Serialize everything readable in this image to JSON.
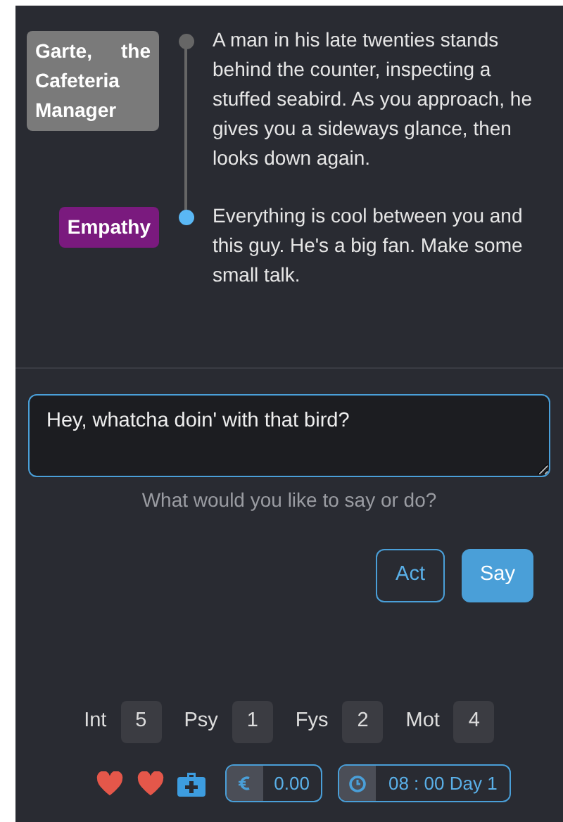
{
  "log": [
    {
      "speaker": "Garte, the Cafeteria Manager",
      "color": "#7a7a7a",
      "current": false,
      "text": "A man in his late twenties stands behind the counter, inspecting a stuffed seabird. As you approach, he gives you a sideways glance, then looks down again."
    },
    {
      "speaker": "Empathy",
      "color": "#7a1a7e",
      "current": true,
      "text": "Everything is cool between you and this guy. He's a big fan. Make some small talk."
    }
  ],
  "input": {
    "value": "Hey, whatcha doin' with that bird?",
    "hint": "What would you like to say or do?"
  },
  "buttons": [
    {
      "label": "Act",
      "kind": "outline"
    },
    {
      "label": "Say",
      "kind": "primary"
    }
  ],
  "stats": [
    {
      "label": "Int",
      "value": "5"
    },
    {
      "label": "Psy",
      "value": "1"
    },
    {
      "label": "Fys",
      "value": "2"
    },
    {
      "label": "Mot",
      "value": "4"
    }
  ],
  "money": "0.00",
  "time": "08 : 00 Day 1"
}
